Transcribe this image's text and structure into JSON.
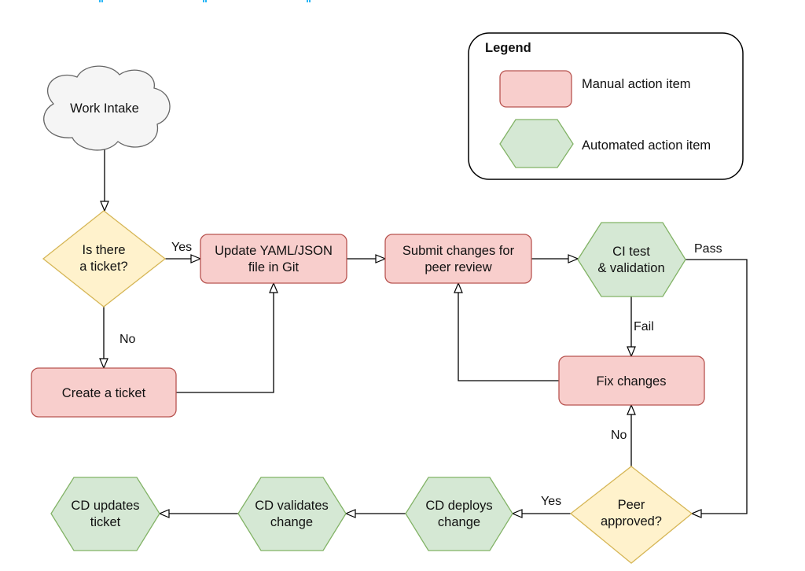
{
  "colors": {
    "manual_fill": "#f8cecc",
    "manual_stroke": "#b85450",
    "auto_fill": "#d5e8d4",
    "auto_stroke": "#82b366",
    "decision_fill": "#fff2cc",
    "decision_stroke": "#d6b656",
    "cloud_fill": "#f5f5f5",
    "cloud_stroke": "#666666"
  },
  "nodes": {
    "work_intake": "Work Intake",
    "is_ticket": [
      "Is there",
      "a ticket?"
    ],
    "update_yaml": [
      "Update YAML/JSON",
      "file in Git"
    ],
    "submit": [
      "Submit changes for",
      "peer review"
    ],
    "ci_test": [
      "CI test",
      "& validation"
    ],
    "create_ticket": "Create a ticket",
    "fix_changes": "Fix changes",
    "peer_approved": [
      "Peer",
      "approved?"
    ],
    "cd_deploys": [
      "CD deploys",
      "change"
    ],
    "cd_validates": [
      "CD validates",
      "change"
    ],
    "cd_updates": [
      "CD updates",
      "ticket"
    ]
  },
  "edges": {
    "yes1": "Yes",
    "no1": "No",
    "pass": "Pass",
    "fail": "Fail",
    "no2": "No",
    "yes2": "Yes"
  },
  "legend": {
    "title": "Legend",
    "manual": "Manual action item",
    "automated": "Automated action item"
  }
}
